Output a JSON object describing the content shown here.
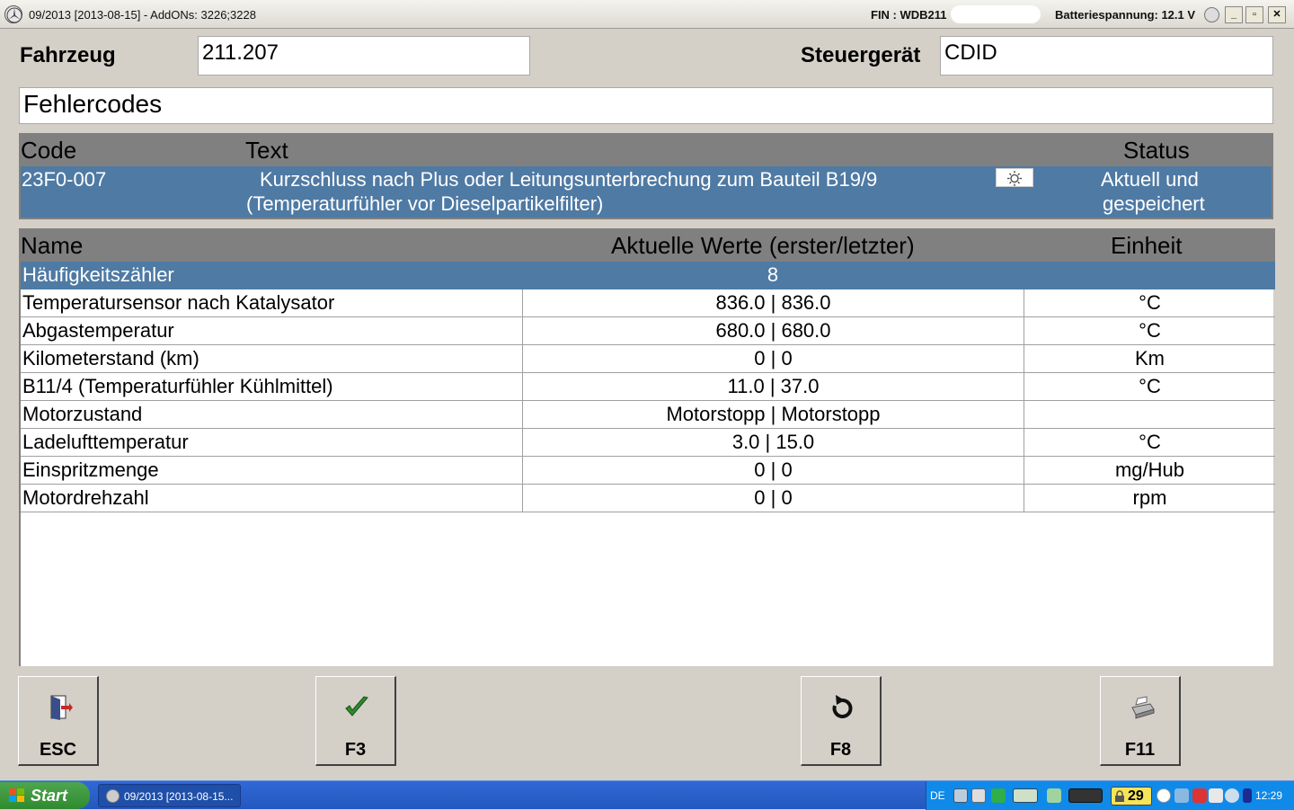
{
  "window": {
    "title": "09/2013 [2013-08-15] - AddONs: 3226;3228",
    "fin_label": "FIN : WDB211",
    "battery": "Batteriespannung: 12.1 V",
    "minimize": "_",
    "maximize": "▫",
    "close": "✕"
  },
  "header": {
    "vehicle_label": "Fahrzeug",
    "vehicle_value": "211.207",
    "ecu_label": "Steuergerät",
    "ecu_value": "CDID",
    "section_title": "Fehlercodes"
  },
  "fault_table": {
    "columns": {
      "code": "Code",
      "text": "Text",
      "status": "Status"
    },
    "row": {
      "code": "23F0-007",
      "text_line1": "Kurzschluss nach Plus oder Leitungsunterbrechung zum Bauteil B19/9",
      "text_line2": "(Temperaturfühler vor Dieselpartikelfilter)",
      "status_line1": "Aktuell und",
      "status_line2": "gespeichert"
    }
  },
  "values_table": {
    "columns": {
      "name": "Name",
      "values": "Aktuelle Werte (erster/letzter)",
      "unit": "Einheit"
    },
    "rows": [
      {
        "name": "Häufigkeitszähler",
        "value": "8",
        "unit": ""
      },
      {
        "name": "Temperatursensor nach Katalysator",
        "value": "836.0 | 836.0",
        "unit": "°C"
      },
      {
        "name": "Abgastemperatur",
        "value": "680.0 | 680.0",
        "unit": "°C"
      },
      {
        "name": "Kilometerstand (km)",
        "value": "0 | 0",
        "unit": "Km"
      },
      {
        "name": "B11/4 (Temperaturfühler Kühlmittel)",
        "value": "11.0 | 37.0",
        "unit": "°C"
      },
      {
        "name": "Motorzustand",
        "value": "Motorstopp | Motorstopp",
        "unit": ""
      },
      {
        "name": "Ladelufttemperatur",
        "value": "3.0 | 15.0",
        "unit": "°C"
      },
      {
        "name": "Einspritzmenge",
        "value": "0 | 0",
        "unit": "mg/Hub"
      },
      {
        "name": "Motordrehzahl",
        "value": "0 | 0",
        "unit": "rpm"
      }
    ]
  },
  "buttons": {
    "esc": "ESC",
    "f3": "F3",
    "f8": "F8",
    "f11": "F11"
  },
  "taskbar": {
    "start": "Start",
    "task": "09/2013 [2013-08-15...",
    "lang": "DE",
    "badge": "29",
    "clock": "12:29"
  },
  "colors": {
    "selection": "#4f7aa4",
    "header_band": "#808080",
    "background": "#d4d0c8"
  }
}
